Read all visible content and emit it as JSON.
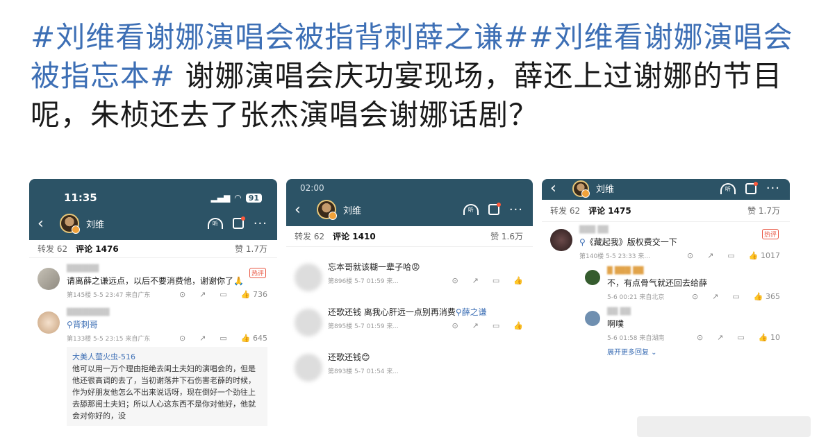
{
  "post": {
    "hashtag1": "#刘维看谢娜演唱会被指背刺薛之谦#",
    "hashtag2": "#刘维看谢娜演唱会被指忘本#",
    "body": " 谢娜演唱会庆功宴现场，薛还上过谢娜的节目呢，朱桢还去了张杰演唱会谢娜话剧？"
  },
  "shot1": {
    "time": "11:35",
    "battery": "91",
    "username": "刘维",
    "tabs": {
      "repost": "转发 62",
      "comments": "评论 1476",
      "likes": "赞 1.7万"
    },
    "comments": [
      {
        "text": "请离薛之谦远点，以后不要消费他，谢谢你了🙏",
        "meta": "第145楼 5-5 23:47 来自广东",
        "likes": "736",
        "hot": "热评"
      },
      {
        "text": "背刺哥",
        "meta": "第133楼 5-5 23:15 来自广东",
        "likes": "645"
      }
    ],
    "reply": {
      "name": "大美人萤火虫-516",
      "text": "他可以用一万个理由拒绝去闺土夫妇的演唱会的，但是他还很高调的去了，当初谢落井下石伤害老薛的时候，作为好朋友他怎么不出来说话呀，现在倒好一个劲往上去舔那闺土夫妇；所以人心这东西不是你对他好，他就会对你好的，没"
    }
  },
  "shot2": {
    "time": "02:00",
    "username": "刘维",
    "tabs": {
      "repost": "转发 62",
      "comments": "评论 1410",
      "likes": "赞 1.6万"
    },
    "comments": [
      {
        "text": "忘本哥就该糊一辈子哈😡",
        "meta": "第896楼 5-7 01:59 来..."
      },
      {
        "text": "还歌还钱 离我心肝远一点别再消费",
        "link": "薛之谦",
        "meta": "第895楼 5-7 01:59 来..."
      },
      {
        "text": "还歌还钱😊",
        "meta": "第893楼 5-7 01:54 来..."
      }
    ]
  },
  "shot3": {
    "username": "刘维",
    "tabs": {
      "repost": "转发 62",
      "comments": "评论 1475",
      "likes": "赞 1.7万"
    },
    "comments": [
      {
        "text": "《藏起我》版权费交一下",
        "meta": "第140楼 5-5 23:33 来...",
        "likes": "1017",
        "hot": "热评"
      },
      {
        "text": "不，有点骨气就还回去给薛",
        "meta": "5-6 00:21 来自北京",
        "likes": "365"
      },
      {
        "text": "啊噗",
        "meta": "5-6 01:58 来自湖南",
        "likes": "10"
      }
    ],
    "more": "展开更多回复"
  }
}
